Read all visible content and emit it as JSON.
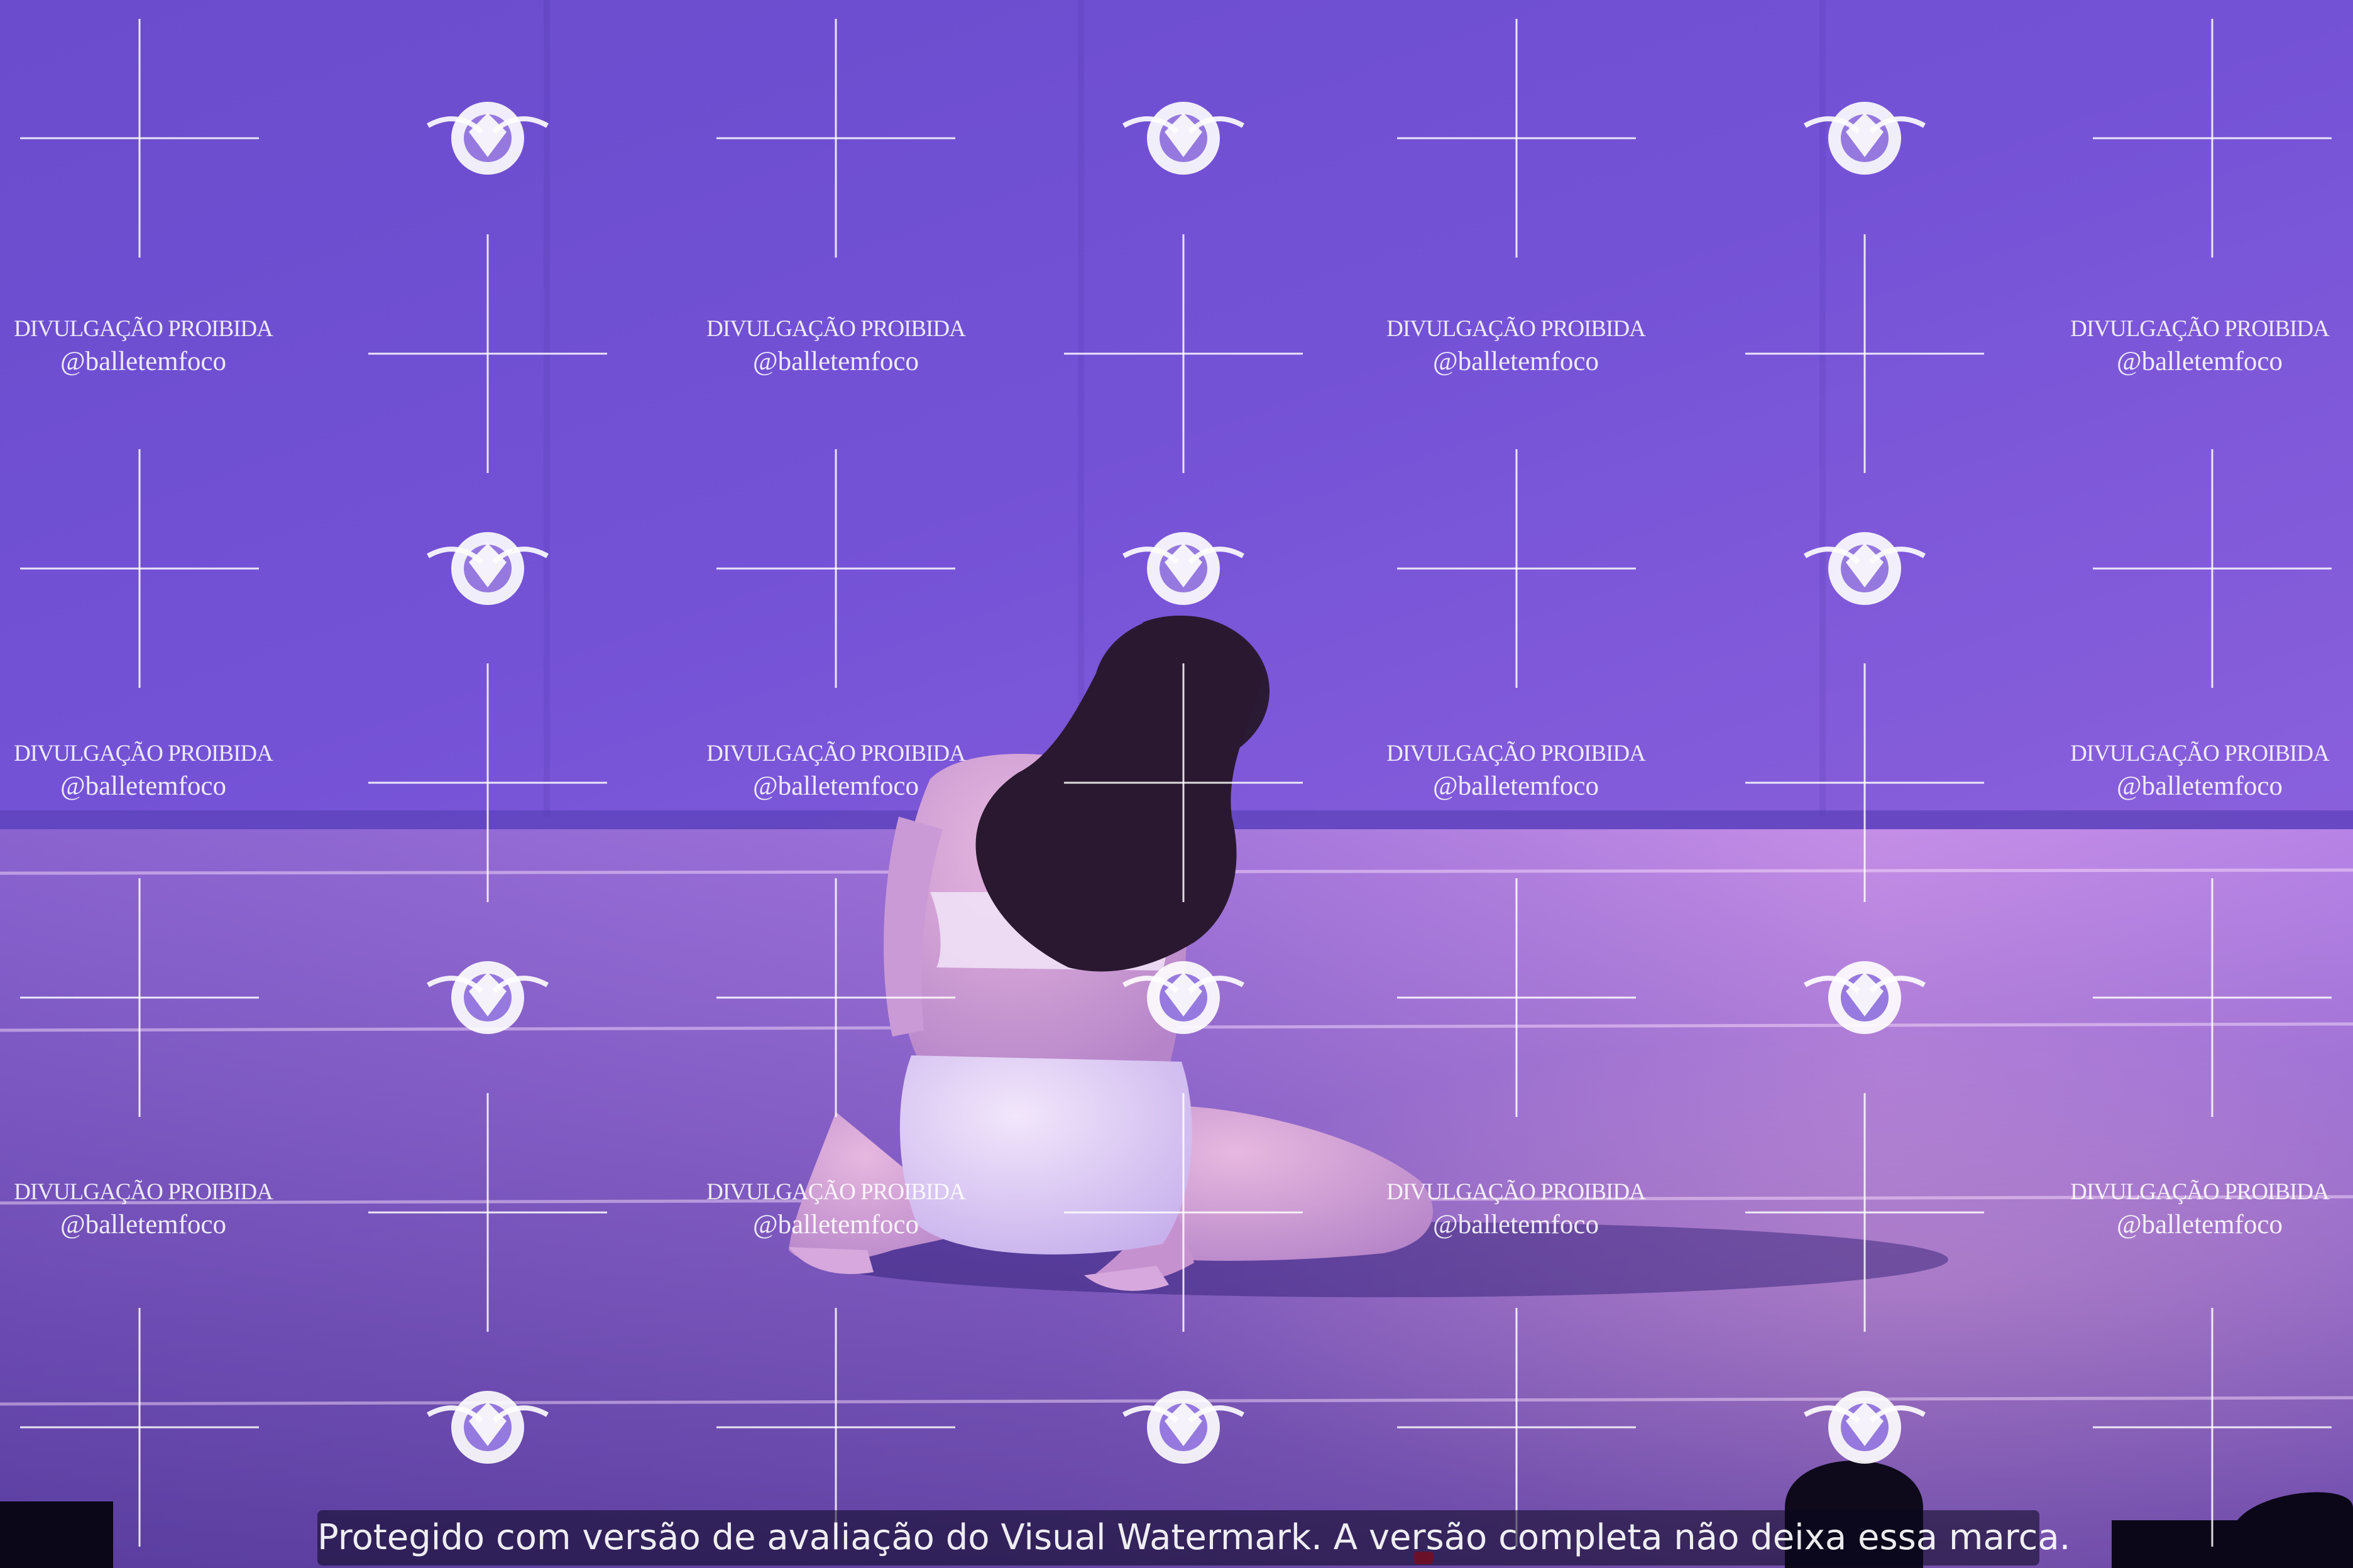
{
  "photo": {
    "subject": "dancer-seated-on-stage",
    "lighting_colors": {
      "backdrop": "#7d5ad8",
      "floor": "#9a6fd8",
      "highlight": "#e6a3e8",
      "shadow": "#3a2a86"
    }
  },
  "watermark": {
    "line1": "DIVULGAÇÃO PROIBIDA",
    "line2": "@balletemfoco",
    "logo_icon": "flower-aperture-logo",
    "cross_icon": "crosshair-mark"
  },
  "footer": {
    "notice": "Protegido com versão de avaliação do Visual Watermark. A versão completa não deixa essa marca."
  }
}
